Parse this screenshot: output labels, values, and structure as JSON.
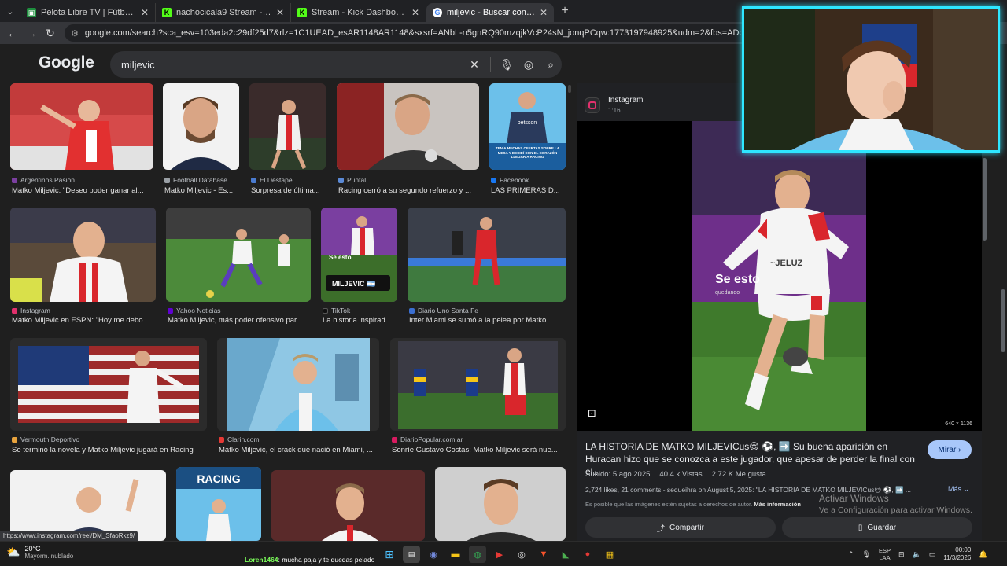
{
  "browser": {
    "tabs": [
      {
        "title": "Pelota Libre TV | Fútbol en Vivo",
        "color": "#1e8e3e"
      },
      {
        "title": "nachocicala9 Stream - Watch Live",
        "color": "#53fc18"
      },
      {
        "title": "Stream - Kick Dashboard",
        "color": "#53fc18"
      },
      {
        "title": "miljevic - Buscar con Google",
        "color": "#4285f4"
      }
    ],
    "url": "google.com/search?sca_esv=103eda2c29df25d7&rlz=1C1UEAD_esAR1148AR1148&sxsrf=ANbL-n5gnRQ90mzqjkVcP24sN_jonqPCqw:1773197948925&udm=2&fbs=ADc_l-bpk8W4E-qsVlOvbGJcDwpn_x-K"
  },
  "google": {
    "logo": "Google",
    "query": "miljevic"
  },
  "results": [
    {
      "source": "Argentinos Pasión",
      "caption": "Matko Miljevic: \"Deseo poder ganar al...",
      "icon_color": "#7b3fa0"
    },
    {
      "source": "Football Database",
      "caption": "Matko Miljevic - Es...",
      "icon_color": "#9aa0a6"
    },
    {
      "source": "El Destape",
      "caption": "Sorpresa de última...",
      "icon_color": "#4a7bd0"
    },
    {
      "source": "Puntal",
      "caption": "Racing cerró a su segundo refuerzo y ...",
      "icon_color": "#5b8ad6"
    },
    {
      "source": "Facebook",
      "caption": "LAS PRIMERAS D...",
      "icon_color": "#1877f2"
    },
    {
      "source": "Instagram",
      "caption": "Matko Miljevic en ESPN: \"Hoy me debo...",
      "icon_color": "#e1306c"
    },
    {
      "source": "Yahoo Noticias",
      "caption": "Matko Miljevic, más poder ofensivo par...",
      "icon_color": "#6001d2"
    },
    {
      "source": "TikTok",
      "caption": "La historia inspirad...",
      "icon_color": "#111111"
    },
    {
      "source": "Diario Uno Santa Fe",
      "caption": "Inter Miami se sumó a la pelea por Matko ...",
      "icon_color": "#3b6fd1"
    },
    {
      "source": "Vermouth Deportivo",
      "caption": "Se terminó la novela y Matko Miljevic jugará en Racing",
      "icon_color": "#e8a33d"
    },
    {
      "source": "Clarin.com",
      "caption": "Matko Miljevic, el crack que nació en Miami, ...",
      "icon_color": "#e53935"
    },
    {
      "source": "DiarioPopular.com.ar",
      "caption": "Sonríe Gustavo Costas: Matko Miljevic será nue...",
      "icon_color": "#d81b60"
    }
  ],
  "overlay_text": {
    "facebook_thumb": "TENÍA MUCHAS OFERTAS SOBRE LA MESA Y DECIDÍ CON EL CORAZÓN LLEGAR A RACING",
    "tiktok_thumb": "MILJEVIC 🇦🇷",
    "tiktok_se_esto": "Se esto",
    "racing_sign": "RACING",
    "sponsor": "betsson"
  },
  "panel": {
    "source_name": "Instagram",
    "duration": "1:16",
    "overlay_big": "Se esto",
    "overlay_small": "quedando",
    "dimensions": "640 × 1136",
    "title": "LA HISTORIA DE MATKO MILJEVICus😌 ⚽, ➡️ Su buena aparición en Huracan hizo que se conozca a este jugador, que apesar de perder la final con el...",
    "watch_label": "Mirar",
    "meta": [
      "Subido: 5 ago 2025",
      "40.4 k Vistas",
      "2.72 K Me gusta"
    ],
    "description": "2,724 likes, 21 comments - sequeihra on August 5, 2025: \"LA HISTORIA DE MATKO MILJEVICus😌 ⚽, ➡️ ...",
    "more_label": "Más",
    "copyright_text": "Es posible que las imágenes estén sujetas a derechos de autor.",
    "copyright_link": "Más información",
    "share_label": "Compartir",
    "save_label": "Guardar"
  },
  "windows_activation": {
    "line1": "Activar Windows",
    "line2": "Ve a Configuración para activar Windows."
  },
  "status_url": "https://www.instagram.com/reel/DM_SfaoRkz9/",
  "taskbar": {
    "temperature": "20°C",
    "weather_desc": "Mayorm. nublado",
    "chat_user": "Loren1464",
    "chat_message": ": mucha paja y te quedas pelado",
    "lang_top": "ESP",
    "lang_bottom": "LAA",
    "time": "00:00",
    "date": "11/3/2026"
  },
  "colors": {
    "accent_webcam": "#2ee7ff",
    "racing_blue": "#6cc0ea",
    "huracan_red": "#d9262c"
  }
}
